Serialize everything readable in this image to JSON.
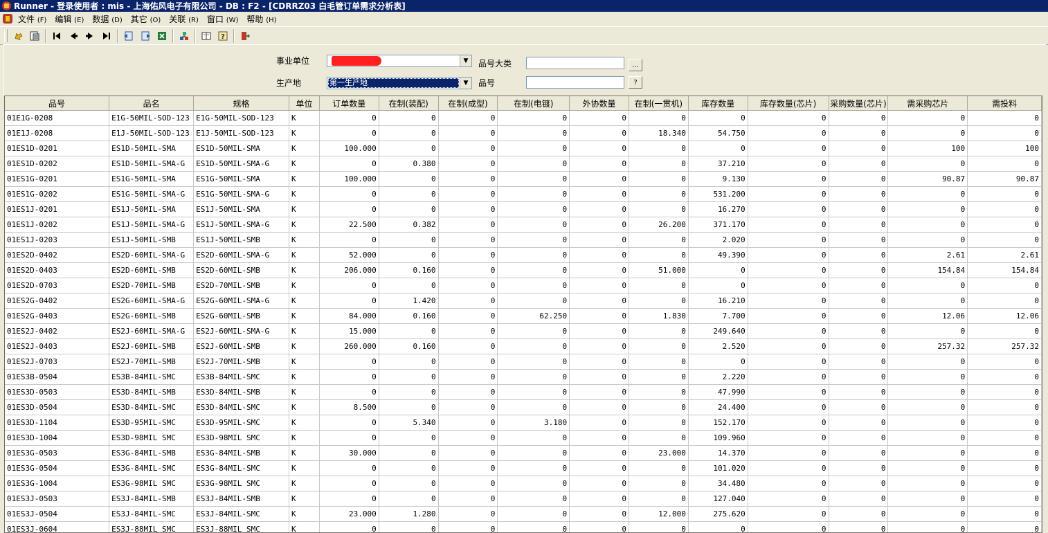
{
  "window": {
    "title": "Runner - 登录使用者 : mis - 上海佑风电子有限公司 - DB : F2 - [CDRRZ03 白毛管订单需求分析表]"
  },
  "menu": [
    {
      "label": "文件",
      "key": "(F)"
    },
    {
      "label": "编辑",
      "key": "(E)"
    },
    {
      "label": "数据",
      "key": "(D)"
    },
    {
      "label": "其它",
      "key": "(O)"
    },
    {
      "label": "关联",
      "key": "(R)"
    },
    {
      "label": "窗口",
      "key": "(W)"
    },
    {
      "label": "帮助",
      "key": "(H)"
    }
  ],
  "toolbar_icons": [
    "retrieve-icon",
    "query-icon",
    "first-record-icon",
    "prev-record-icon",
    "next-record-icon",
    "last-record-icon",
    "import-icon",
    "export-icon",
    "excel-icon",
    "filter-icon",
    "book-icon",
    "help-icon",
    "exit-icon"
  ],
  "form": {
    "business_unit_label": "事业单位",
    "business_unit_value": "",
    "production_site_label": "生产地",
    "production_site_value": "第一生产地",
    "part_category_label": "品号大类",
    "part_category_value": "",
    "part_category_button": "...",
    "part_no_label": "品号",
    "part_no_value": "",
    "part_no_button": "?"
  },
  "colors": {
    "title_bg": "#0a246a",
    "window_bg": "#ece9d8",
    "selection": "#0a246a",
    "redaction": "#ff2020"
  },
  "grid": {
    "columns": [
      "品号",
      "品名",
      "规格",
      "单位",
      "订单数量",
      "在制(装配)",
      "在制(成型)",
      "在制(电镀)",
      "外协数量",
      "在制(一贯机)",
      "库存数量",
      "库存数量(芯片)",
      "采购数量(芯片)",
      "需采购芯片",
      "需投料"
    ],
    "rows": [
      [
        "01E1G-0208",
        "E1G-50MIL-SOD-123",
        "E1G-50MIL-SOD-123",
        "K",
        "0",
        "0",
        "0",
        "0",
        "0",
        "0",
        "0",
        "0",
        "0",
        "0",
        "0"
      ],
      [
        "01E1J-0208",
        "E1J-50MIL-SOD-123",
        "E1J-50MIL-SOD-123",
        "K",
        "0",
        "0",
        "0",
        "0",
        "0",
        "18.340",
        "54.750",
        "0",
        "0",
        "0",
        "0"
      ],
      [
        "01ES1D-0201",
        "ES1D-50MIL-SMA",
        "ES1D-50MIL-SMA",
        "K",
        "100.000",
        "0",
        "0",
        "0",
        "0",
        "0",
        "0",
        "0",
        "0",
        "100",
        "100"
      ],
      [
        "01ES1D-0202",
        "ES1D-50MIL-SMA-G",
        "ES1D-50MIL-SMA-G",
        "K",
        "0",
        "0.380",
        "0",
        "0",
        "0",
        "0",
        "37.210",
        "0",
        "0",
        "0",
        "0"
      ],
      [
        "01ES1G-0201",
        "ES1G-50MIL-SMA",
        "ES1G-50MIL-SMA",
        "K",
        "100.000",
        "0",
        "0",
        "0",
        "0",
        "0",
        "9.130",
        "0",
        "0",
        "90.87",
        "90.87"
      ],
      [
        "01ES1G-0202",
        "ES1G-50MIL-SMA-G",
        "ES1G-50MIL-SMA-G",
        "K",
        "0",
        "0",
        "0",
        "0",
        "0",
        "0",
        "531.200",
        "0",
        "0",
        "0",
        "0"
      ],
      [
        "01ES1J-0201",
        "ES1J-50MIL-SMA",
        "ES1J-50MIL-SMA",
        "K",
        "0",
        "0",
        "0",
        "0",
        "0",
        "0",
        "16.270",
        "0",
        "0",
        "0",
        "0"
      ],
      [
        "01ES1J-0202",
        "ES1J-50MIL-SMA-G",
        "ES1J-50MIL-SMA-G",
        "K",
        "22.500",
        "0.382",
        "0",
        "0",
        "0",
        "26.200",
        "371.170",
        "0",
        "0",
        "0",
        "0"
      ],
      [
        "01ES1J-0203",
        "ES1J-50MIL-SMB",
        "ES1J-50MIL-SMB",
        "K",
        "0",
        "0",
        "0",
        "0",
        "0",
        "0",
        "2.020",
        "0",
        "0",
        "0",
        "0"
      ],
      [
        "01ES2D-0402",
        "ES2D-60MIL-SMA-G",
        "ES2D-60MIL-SMA-G",
        "K",
        "52.000",
        "0",
        "0",
        "0",
        "0",
        "0",
        "49.390",
        "0",
        "0",
        "2.61",
        "2.61"
      ],
      [
        "01ES2D-0403",
        "ES2D-60MIL-SMB",
        "ES2D-60MIL-SMB",
        "K",
        "206.000",
        "0.160",
        "0",
        "0",
        "0",
        "51.000",
        "0",
        "0",
        "0",
        "154.84",
        "154.84"
      ],
      [
        "01ES2D-0703",
        "ES2D-70MIL-SMB",
        "ES2D-70MIL-SMB",
        "K",
        "0",
        "0",
        "0",
        "0",
        "0",
        "0",
        "0",
        "0",
        "0",
        "0",
        "0"
      ],
      [
        "01ES2G-0402",
        "ES2G-60MIL-SMA-G",
        "ES2G-60MIL-SMA-G",
        "K",
        "0",
        "1.420",
        "0",
        "0",
        "0",
        "0",
        "16.210",
        "0",
        "0",
        "0",
        "0"
      ],
      [
        "01ES2G-0403",
        "ES2G-60MIL-SMB",
        "ES2G-60MIL-SMB",
        "K",
        "84.000",
        "0.160",
        "0",
        "62.250",
        "0",
        "1.830",
        "7.700",
        "0",
        "0",
        "12.06",
        "12.06"
      ],
      [
        "01ES2J-0402",
        "ES2J-60MIL-SMA-G",
        "ES2J-60MIL-SMA-G",
        "K",
        "15.000",
        "0",
        "0",
        "0",
        "0",
        "0",
        "249.640",
        "0",
        "0",
        "0",
        "0"
      ],
      [
        "01ES2J-0403",
        "ES2J-60MIL-SMB",
        "ES2J-60MIL-SMB",
        "K",
        "260.000",
        "0.160",
        "0",
        "0",
        "0",
        "0",
        "2.520",
        "0",
        "0",
        "257.32",
        "257.32"
      ],
      [
        "01ES2J-0703",
        "ES2J-70MIL-SMB",
        "ES2J-70MIL-SMB",
        "K",
        "0",
        "0",
        "0",
        "0",
        "0",
        "0",
        "0",
        "0",
        "0",
        "0",
        "0"
      ],
      [
        "01ES3B-0504",
        "ES3B-84MIL-SMC",
        "ES3B-84MIL-SMC",
        "K",
        "0",
        "0",
        "0",
        "0",
        "0",
        "0",
        "2.220",
        "0",
        "0",
        "0",
        "0"
      ],
      [
        "01ES3D-0503",
        "ES3D-84MIL-SMB",
        "ES3D-84MIL-SMB",
        "K",
        "0",
        "0",
        "0",
        "0",
        "0",
        "0",
        "47.990",
        "0",
        "0",
        "0",
        "0"
      ],
      [
        "01ES3D-0504",
        "ES3D-84MIL-SMC",
        "ES3D-84MIL-SMC",
        "K",
        "8.500",
        "0",
        "0",
        "0",
        "0",
        "0",
        "24.400",
        "0",
        "0",
        "0",
        "0"
      ],
      [
        "01ES3D-1104",
        "ES3D-95MIL-SMC",
        "ES3D-95MIL-SMC",
        "K",
        "0",
        "5.340",
        "0",
        "3.180",
        "0",
        "0",
        "152.170",
        "0",
        "0",
        "0",
        "0"
      ],
      [
        "01ES3D-1004",
        "ES3D-98MIL SMC",
        "ES3D-98MIL SMC",
        "K",
        "0",
        "0",
        "0",
        "0",
        "0",
        "0",
        "109.960",
        "0",
        "0",
        "0",
        "0"
      ],
      [
        "01ES3G-0503",
        "ES3G-84MIL-SMB",
        "ES3G-84MIL-SMB",
        "K",
        "30.000",
        "0",
        "0",
        "0",
        "0",
        "23.000",
        "14.370",
        "0",
        "0",
        "0",
        "0"
      ],
      [
        "01ES3G-0504",
        "ES3G-84MIL-SMC",
        "ES3G-84MIL-SMC",
        "K",
        "0",
        "0",
        "0",
        "0",
        "0",
        "0",
        "101.020",
        "0",
        "0",
        "0",
        "0"
      ],
      [
        "01ES3G-1004",
        "ES3G-98MIL SMC",
        "ES3G-98MIL SMC",
        "K",
        "0",
        "0",
        "0",
        "0",
        "0",
        "0",
        "34.480",
        "0",
        "0",
        "0",
        "0"
      ],
      [
        "01ES3J-0503",
        "ES3J-84MIL-SMB",
        "ES3J-84MIL-SMB",
        "K",
        "0",
        "0",
        "0",
        "0",
        "0",
        "0",
        "127.040",
        "0",
        "0",
        "0",
        "0"
      ],
      [
        "01ES3J-0504",
        "ES3J-84MIL-SMC",
        "ES3J-84MIL-SMC",
        "K",
        "23.000",
        "1.280",
        "0",
        "0",
        "0",
        "12.000",
        "275.620",
        "0",
        "0",
        "0",
        "0"
      ],
      [
        "01ES3J-0604",
        "ES3J-88MIL SMC",
        "ES3J-88MIL SMC",
        "K",
        "0",
        "0",
        "0",
        "0",
        "0",
        "0",
        "0",
        "0",
        "0",
        "0",
        "0"
      ]
    ]
  }
}
